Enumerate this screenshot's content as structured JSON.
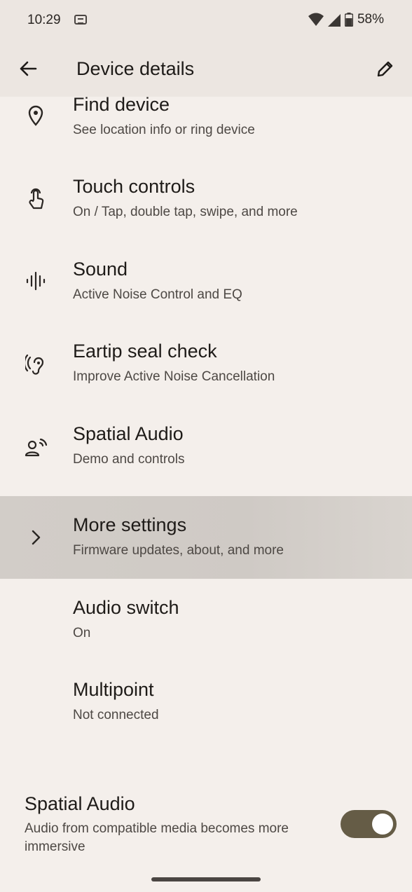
{
  "status_bar": {
    "time": "10:29",
    "battery_percent": "58%",
    "icons": [
      "g-icon",
      "wifi-icon",
      "signal-icon",
      "battery-icon"
    ]
  },
  "app_bar": {
    "title": "Device details",
    "back_icon": "arrow-left-icon",
    "edit_icon": "pencil-icon"
  },
  "items": [
    {
      "title": "Find device",
      "subtitle": "See location info or ring device",
      "icon": "location-pin-icon"
    },
    {
      "title": "Touch controls",
      "subtitle": "On / Tap, double tap, swipe, and more",
      "icon": "touch-icon"
    },
    {
      "title": "Sound",
      "subtitle": "Active Noise Control and EQ",
      "icon": "audio-wave-icon"
    },
    {
      "title": "Eartip seal check",
      "subtitle": "Improve Active Noise Cancellation",
      "icon": "ear-icon"
    },
    {
      "title": "Spatial Audio",
      "subtitle": "Demo and controls",
      "icon": "spatial-audio-icon"
    },
    {
      "title": "More settings",
      "subtitle": "Firmware updates, about, and more",
      "icon": "chevron-right-icon"
    },
    {
      "title": "Audio switch",
      "subtitle": "On"
    },
    {
      "title": "Multipoint",
      "subtitle": "Not connected"
    }
  ],
  "spatial_toggle": {
    "title": "Spatial Audio",
    "subtitle": "Audio from compatible media becomes more immersive",
    "state": "on"
  },
  "colors": {
    "background": "#f4efeb",
    "app_bar": "#ece6e1",
    "highlight_row": "#d2cdc8",
    "toggle_track": "#655c46"
  }
}
